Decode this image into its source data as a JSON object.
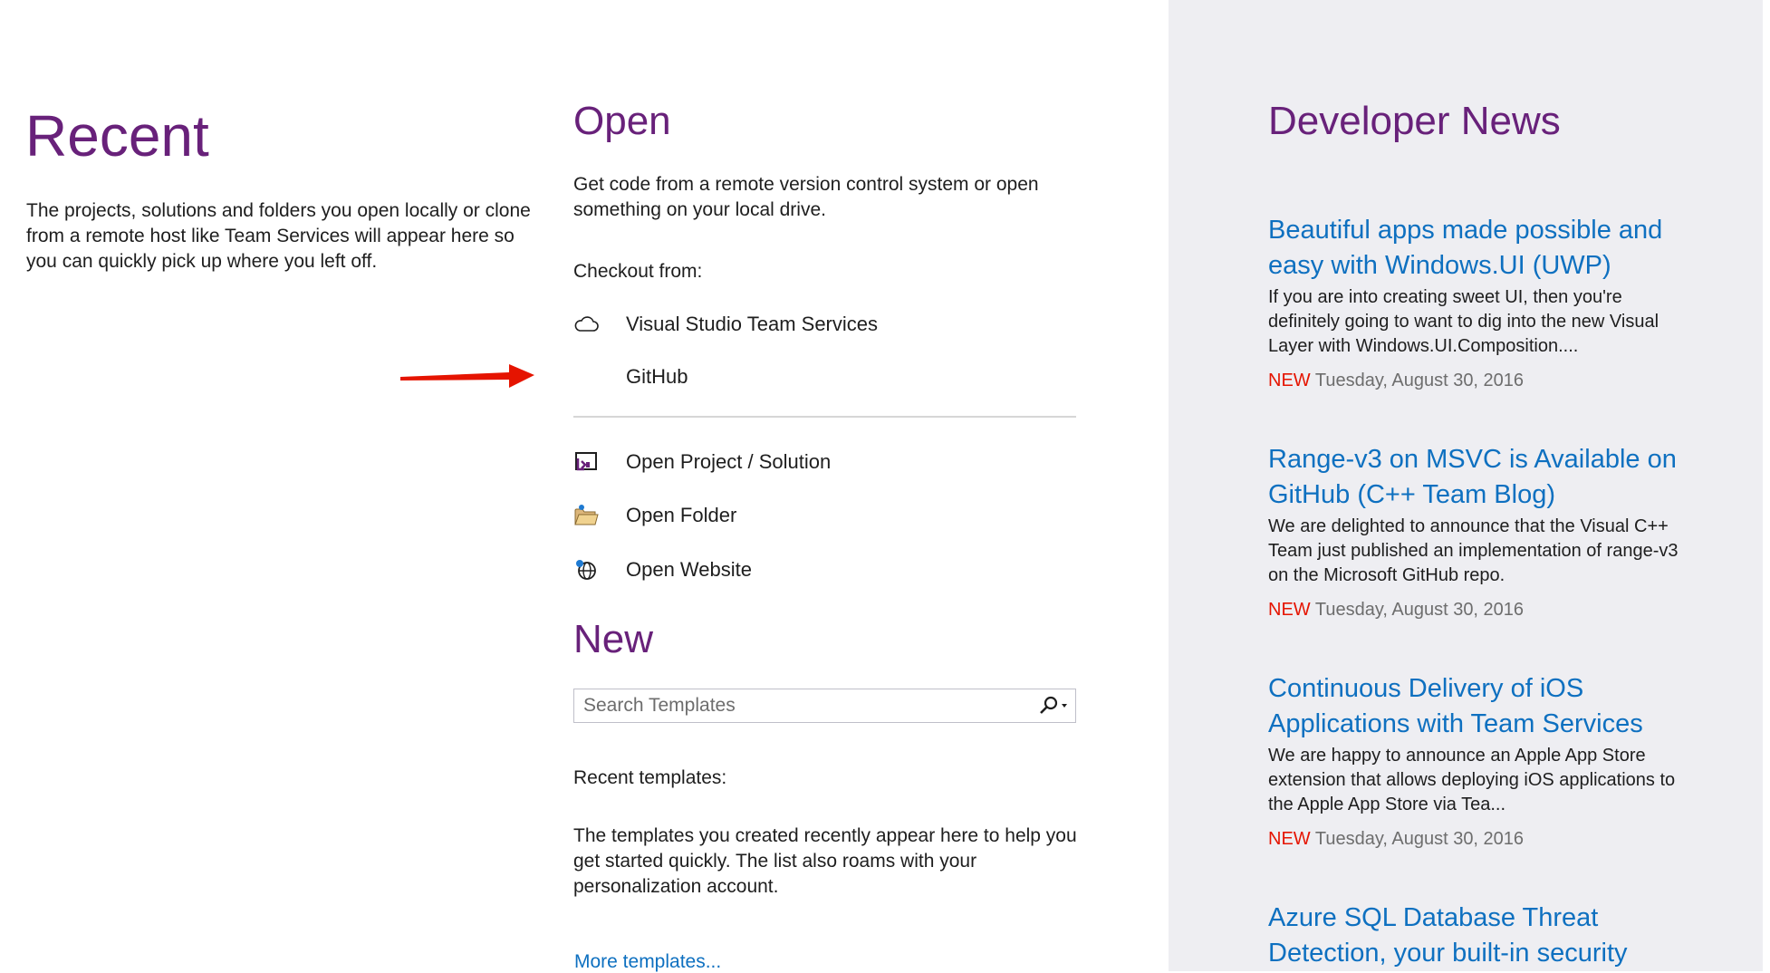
{
  "recent": {
    "title": "Recent",
    "description": "The projects, solutions and folders you open locally or clone from a remote host like Team Services will appear here so you can quickly pick up where you left off."
  },
  "open": {
    "title": "Open",
    "description": "Get code from a remote version control system or open something on your local drive.",
    "checkout_label": "Checkout from:",
    "checkout_items": [
      {
        "label": "Visual Studio Team Services",
        "icon": "cloud-icon"
      },
      {
        "label": "GitHub",
        "icon": ""
      }
    ],
    "actions": [
      {
        "label": "Open Project / Solution",
        "icon": "open-project-icon"
      },
      {
        "label": "Open Folder",
        "icon": "open-folder-icon"
      },
      {
        "label": "Open Website",
        "icon": "open-website-icon"
      }
    ]
  },
  "new": {
    "title": "New",
    "search_placeholder": "Search Templates",
    "recent_templates_label": "Recent templates:",
    "templates_description": "The templates you created recently appear here to help you get started quickly. The list also roams with your personalization account.",
    "more_templates": "More templates..."
  },
  "news": {
    "title": "Developer News",
    "items": [
      {
        "title": "Beautiful apps made possible and easy with Windows.UI (UWP)",
        "body": "If you are into creating sweet UI, then you're definitely going to want to dig into the new Visual Layer with Windows.UI.Composition....",
        "badge": "NEW",
        "date": "Tuesday, August 30, 2016"
      },
      {
        "title": "Range-v3 on MSVC is Available on GitHub (C++ Team Blog)",
        "body": "We are delighted to announce that the Visual C++ Team just published an implementation of range-v3 on the Microsoft GitHub repo.",
        "badge": "NEW",
        "date": "Tuesday, August 30, 2016"
      },
      {
        "title": "Continuous Delivery of iOS Applications with Team Services",
        "body": "We are happy to announce an Apple App Store extension that allows deploying iOS applications to the Apple App Store via Tea...",
        "badge": "NEW",
        "date": "Tuesday, August 30, 2016"
      },
      {
        "title": "Azure SQL Database Threat Detection, your built-in security"
      }
    ]
  },
  "colors": {
    "heading": "#68217a",
    "link": "#0e70c0",
    "new_badge": "#e51400",
    "news_panel_bg": "#eeeef2",
    "annotation_arrow": "#e51400"
  }
}
